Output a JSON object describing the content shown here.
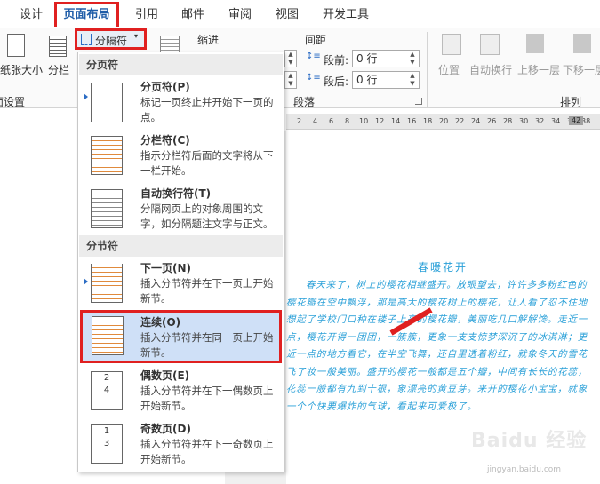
{
  "tabs": [
    "设计",
    "页面布局",
    "引用",
    "邮件",
    "审阅",
    "视图",
    "开发工具"
  ],
  "ribbon": {
    "paper_size_label": "纸张大小",
    "columns_label": "分栏",
    "page_setup_group": "页面设置",
    "breaks_button": "分隔符",
    "indent_label": "缩进",
    "spacing_label": "间距",
    "before_label": "段前:",
    "before_value": "0 行",
    "after_label": "段后:",
    "after_value": "0 行",
    "paragraph_group": "段落",
    "position_label": "位置",
    "wrap_label": "自动换行",
    "bring_forward_label": "上移一层",
    "send_backward_label": "下移一层",
    "arrange_group": "排列"
  },
  "ruler_ticks": [
    "2",
    "4",
    "6",
    "8",
    "10",
    "12",
    "14",
    "16",
    "18",
    "20",
    "22",
    "24",
    "26",
    "28",
    "30",
    "32",
    "34",
    "36",
    "38",
    "42"
  ],
  "dropdown": {
    "page_breaks_header": "分页符",
    "section_breaks_header": "分节符",
    "items": [
      {
        "title": "分页符(P)",
        "desc": "标记一页终止并开始下一页的点。"
      },
      {
        "title": "分栏符(C)",
        "desc": "指示分栏符后面的文字将从下一栏开始。"
      },
      {
        "title": "自动换行符(T)",
        "desc": "分隔网页上的对象周围的文字，如分隔题注文字与正文。"
      },
      {
        "title": "下一页(N)",
        "desc": "插入分节符并在下一页上开始新节。"
      },
      {
        "title": "连续(O)",
        "desc": "插入分节符并在同一页上开始新节。"
      },
      {
        "title": "偶数页(E)",
        "desc": "插入分节符并在下一偶数页上开始新节。"
      },
      {
        "title": "奇数页(D)",
        "desc": "插入分节符并在下一奇数页上开始新节。"
      }
    ]
  },
  "document": {
    "title": "春暖花开",
    "body": "春天来了，树上的樱花相继盛开。放眼望去，许许多多粉红色的樱花瓣在空中飘浮，那是高大的樱花树上的樱花，让人看了忍不住地想起了学校门口种在楼子上亭的樱花瓣，美丽吃几口解解馋。走近一点，樱花开得一团团，一簇簇，更象一支支惊梦深沉了的冰淇淋；更近一点的地方看它，在半空飞舞，还自里透着粉红，就象冬天的雪花飞了妆一般美丽。盛开的樱花一般都是五个瓣，中间有长长的花蕊，花蕊一般都有九到十根，象漂亮的黄豆芽。来开的樱花小宝宝，就象一个个快要爆炸的气球，看起来可爱极了。"
  },
  "watermark": {
    "logo": "Baidu 经验",
    "url": "jingyan.baidu.com"
  }
}
